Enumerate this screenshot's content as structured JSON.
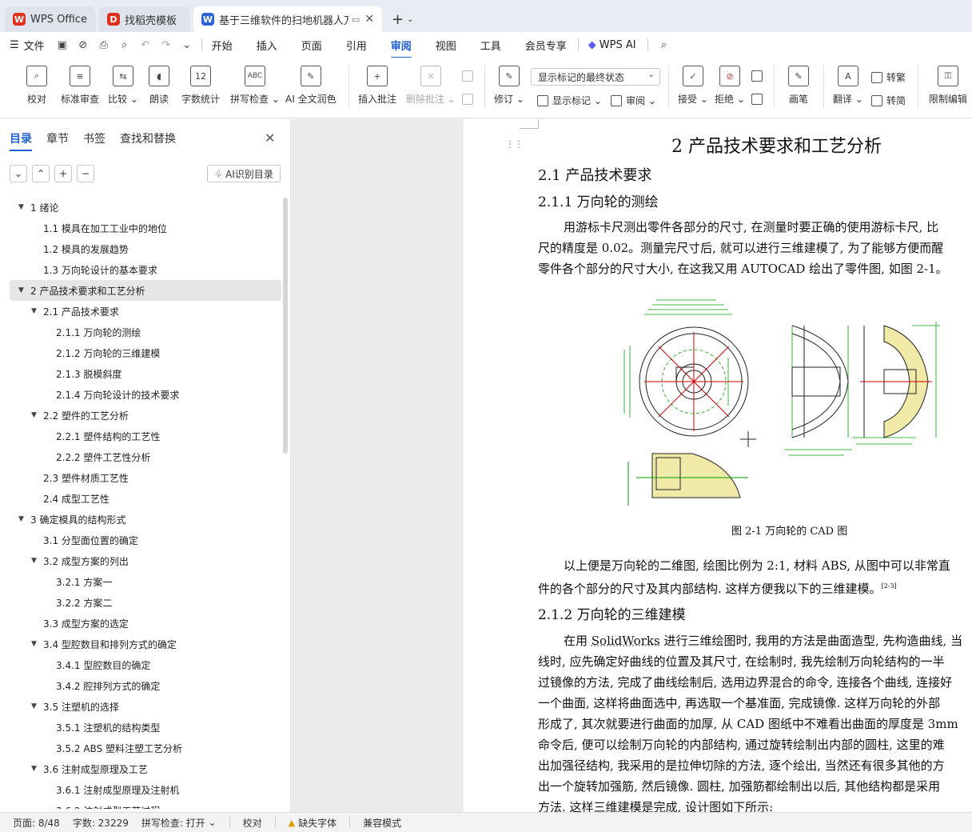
{
  "tabs": [
    {
      "label": "WPS Office",
      "icon": "wps-logo-icon",
      "color": "#e0301e"
    },
    {
      "label": "找稻壳模板",
      "icon": "docer-icon",
      "color": "#e0301e"
    },
    {
      "label": "基于三维软件的扫地机器人万",
      "icon": "word-doc-icon",
      "color": "#2a62d8"
    }
  ],
  "menu": {
    "file": "文件",
    "items": [
      "开始",
      "插入",
      "页面",
      "引用",
      "审阅",
      "视图",
      "工具",
      "会员专享"
    ],
    "selected": "审阅",
    "wps_ai": "WPS AI"
  },
  "ribbon": {
    "proofread": "校对",
    "standard_review": "标准审查",
    "compare": "比较",
    "read_aloud": "朗读",
    "word_count": "字数统计",
    "spell_check": "拼写检查",
    "ai_polish": "AI 全文润色",
    "insert_comment": "插入批注",
    "delete_comment": "删除批注",
    "track_changes": "修订",
    "markup_combo": "显示标记的最终状态",
    "show_markup": "显示标记",
    "review": "审阅",
    "accept": "接受",
    "reject": "拒绝",
    "pen": "画笔",
    "translate": "翻译",
    "to_traditional": "转繁",
    "to_simplified": "转简",
    "restrict_edit": "限制编辑",
    "word_count_icon_text": "12",
    "spell_icon_text": "ABC"
  },
  "leftpanel": {
    "tabs": [
      "目录",
      "章节",
      "书签",
      "查找和替换"
    ],
    "selected_tab": "目录",
    "ai_toc": "AI识别目录",
    "toc": [
      {
        "text": "1  绪论",
        "level": 1
      },
      {
        "text": "1.1  模具在加工工业中的地位",
        "level": 2
      },
      {
        "text": "1.2  模具的发展趋势",
        "level": 2
      },
      {
        "text": "1.3  万向轮设计的基本要求",
        "level": 2
      },
      {
        "text": "2  产品技术要求和工艺分析",
        "level": 1,
        "selected": true
      },
      {
        "text": "2.1  产品技术要求",
        "level": 2,
        "expandable": true
      },
      {
        "text": "2.1.1  万向轮的测绘",
        "level": 3
      },
      {
        "text": "2.1.2  万向轮的三维建模",
        "level": 3
      },
      {
        "text": "2.1.3  脱模斜度",
        "level": 3
      },
      {
        "text": "2.1.4  万向轮设计的技术要求",
        "level": 3
      },
      {
        "text": "2.2  塑件的工艺分析",
        "level": 2,
        "expandable": true
      },
      {
        "text": "2.2.1  塑件结构的工艺性",
        "level": 3
      },
      {
        "text": "2.2.2  塑件工艺性分析",
        "level": 3
      },
      {
        "text": "2.3  塑件材质工艺性",
        "level": 2
      },
      {
        "text": "2.4  成型工艺性",
        "level": 2
      },
      {
        "text": "3  确定模具的结构形式",
        "level": 1
      },
      {
        "text": "3.1  分型面位置的确定",
        "level": 2
      },
      {
        "text": "3.2  成型方案的列出",
        "level": 2,
        "expandable": true
      },
      {
        "text": "3.2.1  方案一",
        "level": 3
      },
      {
        "text": "3.2.2  方案二",
        "level": 3
      },
      {
        "text": "3.3  成型方案的选定",
        "level": 2
      },
      {
        "text": "3.4  型腔数目和排列方式的确定",
        "level": 2,
        "expandable": true
      },
      {
        "text": "3.4.1  型腔数目的确定",
        "level": 3
      },
      {
        "text": "3.4.2  腔排列方式的确定",
        "level": 3
      },
      {
        "text": "3.5  注塑机的选择",
        "level": 2,
        "expandable": true
      },
      {
        "text": "3.5.1  注塑机的结构类型",
        "level": 3
      },
      {
        "text": "3.5.2 ABS 塑料注塑工艺分析",
        "level": 3
      },
      {
        "text": "3.6  注射成型原理及工艺",
        "level": 2,
        "expandable": true
      },
      {
        "text": "3.6.1  注射成型原理及注射机",
        "level": 3
      },
      {
        "text": "3.6.2  注射成型工艺过程",
        "level": 3
      }
    ]
  },
  "document": {
    "h1": "2  产品技术要求和工艺分析",
    "h2_1": "2.1  产品技术要求",
    "h3_1": "2.1.1  万向轮的测绘",
    "p1": [
      "用游标卡尺测出零件各部分的尺寸, 在测量时要正确的使用游标卡尺, 比",
      "尺的精度是 0.02。测量完尺寸后, 就可以进行三维建模了, 为了能够方便而醒",
      "零件各个部分的尺寸大小, 在这我又用 AUTOCAD 绘出了零件图, 如图 2-1。"
    ],
    "figure_caption": "图 2-1 万向轮的 CAD 图",
    "p2": [
      "以上便是万向轮的二维图, 绘图比例为 2:1, 材料 ABS, 从图中可以非常直",
      "件的各个部分的尺寸及其内部结构. 这样方便我以下的三维建模。"
    ],
    "p2_cite": "[2-3]",
    "h3_2": "2.1.2  万向轮的三维建模",
    "p3_first_prefix": "在用 ",
    "p3_first_solidworks": "SolidWorks",
    "p3_first_suffix": " 进行三维绘图时, 我用的方法是曲面造型, 先构造曲线, 当",
    "p3": [
      "线时, 应先确定好曲线的位置及其尺寸, 在绘制时, 我先绘制万向轮结构的一半",
      "过镜像的方法, 完成了曲线绘制后, 选用边界混合的命令, 连接各个曲线, 连接好",
      "一个曲面, 这样将曲面选中, 再选取一个基准面, 完成镜像. 这样万向轮的外部",
      "形成了, 其次就要进行曲面的加厚, 从 CAD 图纸中不难看出曲面的厚度是 3mm",
      "命令后, 便可以绘制万向轮的内部结构, 通过旋转绘制出内部的圆柱, 这里的难",
      "出加强径结构, 我采用的是拉伸切除的方法, 逐个绘出, 当然还有很多其他的方",
      "出一个旋转加强筋, 然后镜像. 圆柱, 加强筋都绘制出以后, 其他结构都是采用",
      "方法. 这样三维建模是完成, 设计图如下所示:"
    ]
  },
  "status": {
    "page": "页面: 8/48",
    "words": "字数: 23229",
    "spell": "拼写检查: 打开",
    "proof": "校对",
    "missing_font": "缺失字体",
    "compat": "兼容模式"
  }
}
